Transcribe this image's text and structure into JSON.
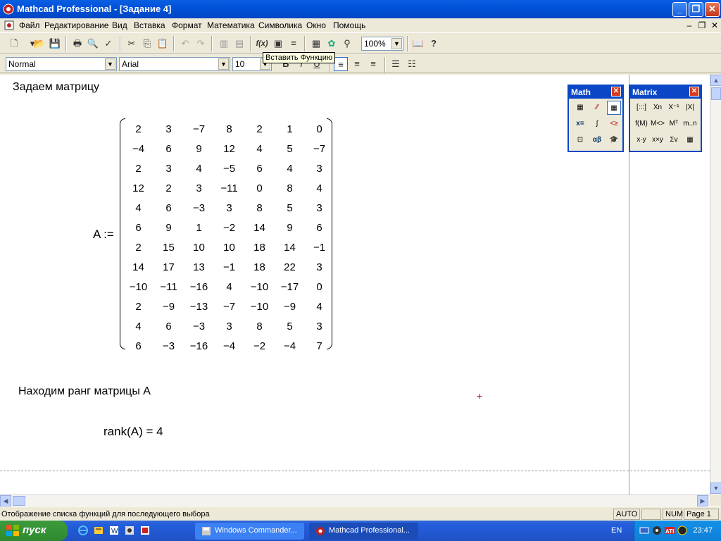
{
  "window": {
    "title": "Mathcad Professional - [Задание 4]"
  },
  "menu": [
    "Файл",
    "Редактирование",
    "Вид",
    "Вставка",
    "Формат",
    "Математика",
    "Символика",
    "Окно",
    "Помощь"
  ],
  "toolbar": {
    "zoom": "100%",
    "style": "Normal",
    "font": "Arial",
    "size": "10",
    "function_button": "f(x)"
  },
  "tooltip": "Вставить Функцию",
  "document": {
    "heading1": "Задаем матрицу",
    "matrix_label": "A :=",
    "matrix": [
      [
        "2",
        "3",
        "−7",
        "8",
        "2",
        "1",
        "0"
      ],
      [
        "−4",
        "6",
        "9",
        "12",
        "4",
        "5",
        "−7"
      ],
      [
        "2",
        "3",
        "4",
        "−5",
        "6",
        "4",
        "3"
      ],
      [
        "12",
        "2",
        "3",
        "−11",
        "0",
        "8",
        "4"
      ],
      [
        "4",
        "6",
        "−3",
        "3",
        "8",
        "5",
        "3"
      ],
      [
        "6",
        "9",
        "1",
        "−2",
        "14",
        "9",
        "6"
      ],
      [
        "2",
        "15",
        "10",
        "10",
        "18",
        "14",
        "−1"
      ],
      [
        "14",
        "17",
        "13",
        "−1",
        "18",
        "22",
        "3"
      ],
      [
        "−10",
        "−11",
        "−16",
        "4",
        "−10",
        "−17",
        "0"
      ],
      [
        "2",
        "−9",
        "−13",
        "−7",
        "−10",
        "−9",
        "4"
      ],
      [
        "4",
        "6",
        "−3",
        "3",
        "8",
        "5",
        "3"
      ],
      [
        "6",
        "−3",
        "−16",
        "−4",
        "−2",
        "−4",
        "7"
      ]
    ],
    "heading2": "Находим ранг матрицы A",
    "result": "rank(A) = 4",
    "cursor": "+"
  },
  "palettes": {
    "math": {
      "title": "Math"
    },
    "matrix": {
      "title": "Matrix",
      "buttons": [
        "[:::]",
        "Xn",
        "X⁻¹",
        "|X|",
        "f(M)",
        "M<>",
        "Mᵀ",
        "m..n",
        "x·y",
        "x×y",
        "Σv",
        "▦"
      ]
    }
  },
  "statusbar": {
    "message": "Отображение списка функций для последующего выбора",
    "mode": "AUTO",
    "num": "NUM",
    "page": "Page 1"
  },
  "taskbar": {
    "start": "пуск",
    "tasks": [
      "Windows Commander...",
      "Mathcad Professional..."
    ],
    "lang": "EN",
    "clock": "23:47"
  }
}
